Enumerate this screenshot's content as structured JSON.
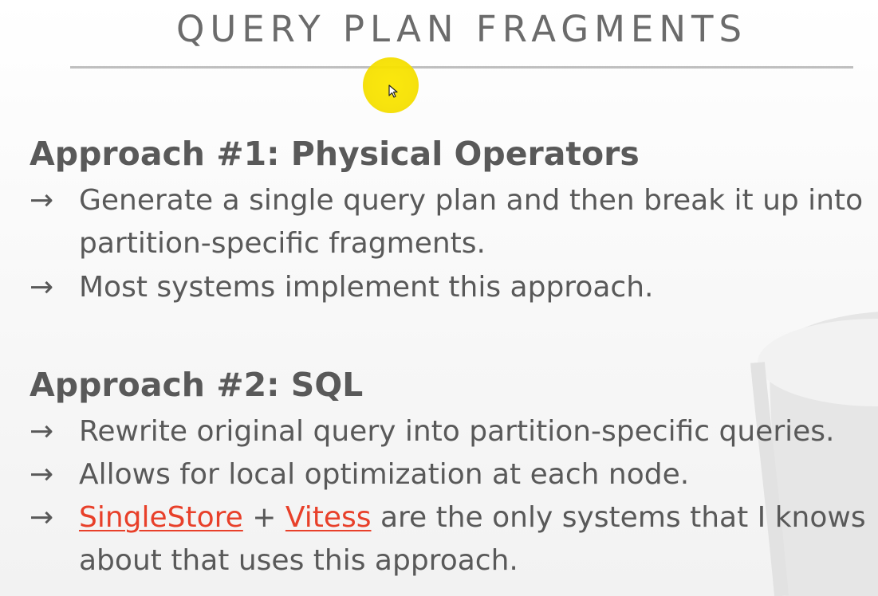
{
  "slide": {
    "title": "QUERY PLAN FRAGMENTS"
  },
  "section1": {
    "heading": "Approach #1: Physical Operators",
    "bullets": [
      {
        "arrow": "→",
        "line1": "Generate a single query plan and then break it up into",
        "line2": "partition-specific fragments."
      },
      {
        "arrow": "→",
        "line1": "Most systems implement this approach."
      }
    ]
  },
  "section2": {
    "heading": "Approach #2: SQL",
    "bullets": [
      {
        "arrow": "→",
        "line1": "Rewrite original query into partition-specific queries."
      },
      {
        "arrow": "→",
        "line1": "Allows for local optimization at each node."
      },
      {
        "arrow": "→",
        "link1": "SingleStore",
        "plus": " + ",
        "link2": "Vitess",
        "rest": " are the only systems that I knows",
        "line2": "about that uses this approach."
      }
    ]
  },
  "colors": {
    "text": "#595959",
    "link": "#e8402a",
    "cursor_highlight": "#f6e100"
  },
  "icons": {
    "cursor": "mouse-pointer-icon",
    "watermark": "database-cylinder-icon"
  }
}
